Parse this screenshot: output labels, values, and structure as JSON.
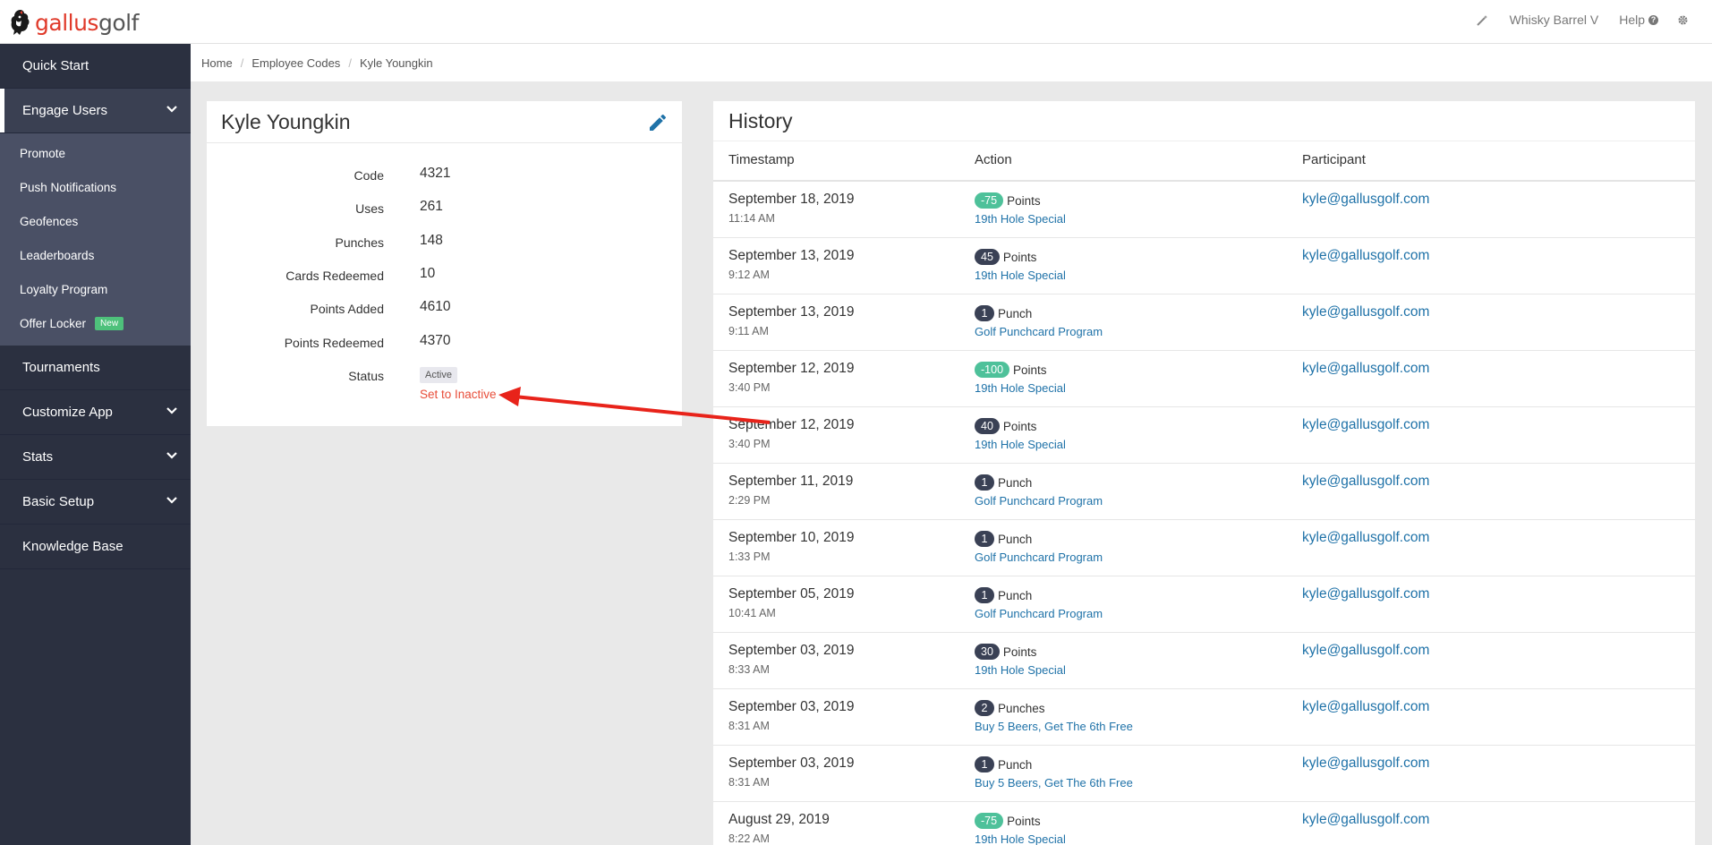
{
  "brand": {
    "logo_red": "gallus",
    "logo_gray": "golf",
    "accent": "#e03a2a"
  },
  "topbar": {
    "org_name": "Whisky Barrel V",
    "help_label": "Help"
  },
  "sidebar": {
    "items": [
      {
        "label": "Quick Start"
      },
      {
        "label": "Engage Users"
      },
      {
        "label": "Tournaments"
      },
      {
        "label": "Customize App"
      },
      {
        "label": "Stats"
      },
      {
        "label": "Basic Setup"
      },
      {
        "label": "Knowledge Base"
      }
    ],
    "engage_sub": [
      {
        "label": "Promote"
      },
      {
        "label": "Push Notifications"
      },
      {
        "label": "Geofences"
      },
      {
        "label": "Leaderboards"
      },
      {
        "label": "Loyalty Program"
      },
      {
        "label": "Offer Locker",
        "badge": "New"
      }
    ]
  },
  "breadcrumb": {
    "home": "Home",
    "section": "Employee Codes",
    "current": "Kyle Youngkin"
  },
  "detail": {
    "title": "Kyle Youngkin",
    "fields": [
      {
        "label": "Code",
        "value": "4321"
      },
      {
        "label": "Uses",
        "value": "261"
      },
      {
        "label": "Punches",
        "value": "148"
      },
      {
        "label": "Cards Redeemed",
        "value": "10"
      },
      {
        "label": "Points Added",
        "value": "4610"
      },
      {
        "label": "Points Redeemed",
        "value": "4370"
      }
    ],
    "status_label": "Status",
    "status_value": "Active",
    "set_inactive": "Set to Inactive"
  },
  "history": {
    "title": "History",
    "columns": {
      "timestamp": "Timestamp",
      "action": "Action",
      "participant": "Participant"
    },
    "rows": [
      {
        "date": "September 18, 2019",
        "time": "11:14 AM",
        "amount": "-75",
        "unit": "Points",
        "program": "19th Hole Special",
        "email": "kyle@gallusgolf.com"
      },
      {
        "date": "September 13, 2019",
        "time": "9:12 AM",
        "amount": "45",
        "unit": "Points",
        "program": "19th Hole Special",
        "email": "kyle@gallusgolf.com"
      },
      {
        "date": "September 13, 2019",
        "time": "9:11 AM",
        "amount": "1",
        "unit": "Punch",
        "program": "Golf Punchcard Program",
        "email": "kyle@gallusgolf.com"
      },
      {
        "date": "September 12, 2019",
        "time": "3:40 PM",
        "amount": "-100",
        "unit": "Points",
        "program": "19th Hole Special",
        "email": "kyle@gallusgolf.com"
      },
      {
        "date": "September 12, 2019",
        "time": "3:40 PM",
        "amount": "40",
        "unit": "Points",
        "program": "19th Hole Special",
        "email": "kyle@gallusgolf.com"
      },
      {
        "date": "September 11, 2019",
        "time": "2:29 PM",
        "amount": "1",
        "unit": "Punch",
        "program": "Golf Punchcard Program",
        "email": "kyle@gallusgolf.com"
      },
      {
        "date": "September 10, 2019",
        "time": "1:33 PM",
        "amount": "1",
        "unit": "Punch",
        "program": "Golf Punchcard Program",
        "email": "kyle@gallusgolf.com"
      },
      {
        "date": "September 05, 2019",
        "time": "10:41 AM",
        "amount": "1",
        "unit": "Punch",
        "program": "Golf Punchcard Program",
        "email": "kyle@gallusgolf.com"
      },
      {
        "date": "September 03, 2019",
        "time": "8:33 AM",
        "amount": "30",
        "unit": "Points",
        "program": "19th Hole Special",
        "email": "kyle@gallusgolf.com"
      },
      {
        "date": "September 03, 2019",
        "time": "8:31 AM",
        "amount": "2",
        "unit": "Punches",
        "program": "Buy 5 Beers, Get The 6th Free",
        "email": "kyle@gallusgolf.com"
      },
      {
        "date": "September 03, 2019",
        "time": "8:31 AM",
        "amount": "1",
        "unit": "Punch",
        "program": "Buy 5 Beers, Get The 6th Free",
        "email": "kyle@gallusgolf.com"
      },
      {
        "date": "August 29, 2019",
        "time": "8:22 AM",
        "amount": "-75",
        "unit": "Points",
        "program": "19th Hole Special",
        "email": "kyle@gallusgolf.com"
      }
    ]
  }
}
